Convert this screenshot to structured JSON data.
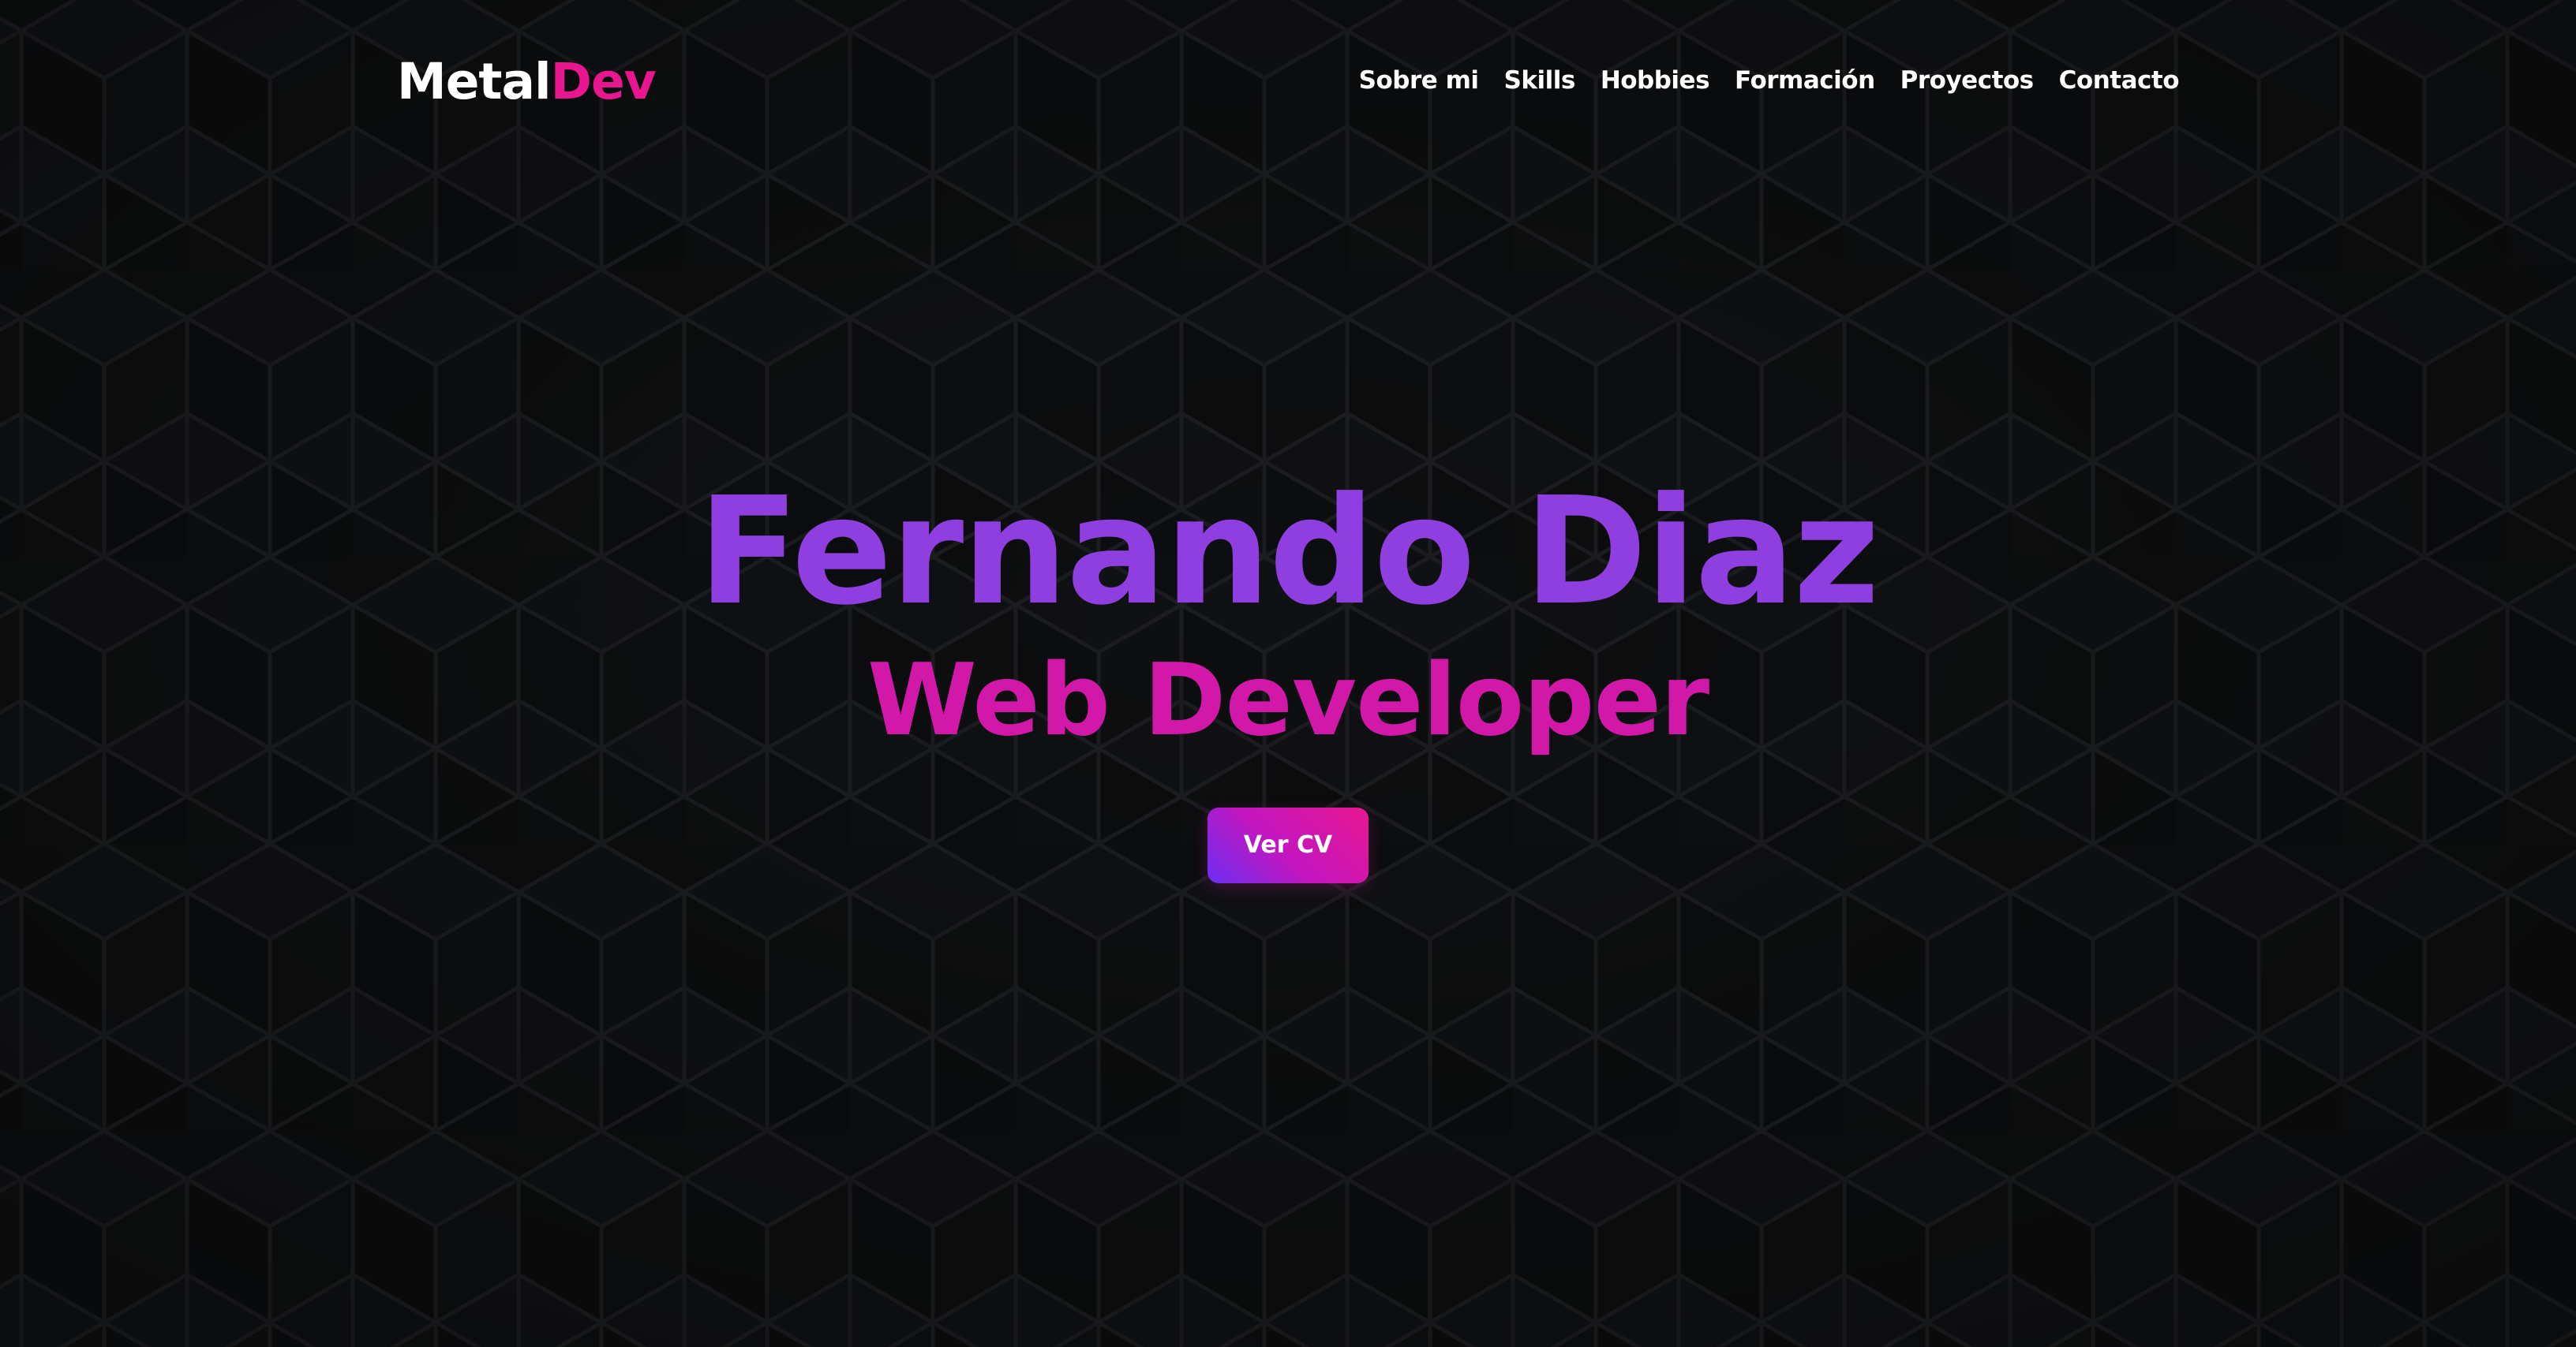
{
  "brand": {
    "logo_part1": "Metal",
    "logo_part2": "Dev",
    "accent_color": "#e8178f"
  },
  "nav": {
    "items": [
      {
        "label": "Sobre mi"
      },
      {
        "label": "Skills"
      },
      {
        "label": "Hobbies"
      },
      {
        "label": "Formación"
      },
      {
        "label": "Proyectos"
      },
      {
        "label": "Contacto"
      }
    ]
  },
  "hero": {
    "name": "Fernando Diaz",
    "role": "Web Developer",
    "cv_button": "Ver CV",
    "name_color": "#8f3fe0",
    "role_color": "#d118a8"
  },
  "colors": {
    "background": "#0d0e0f",
    "pattern_line": "#1c1d20"
  }
}
